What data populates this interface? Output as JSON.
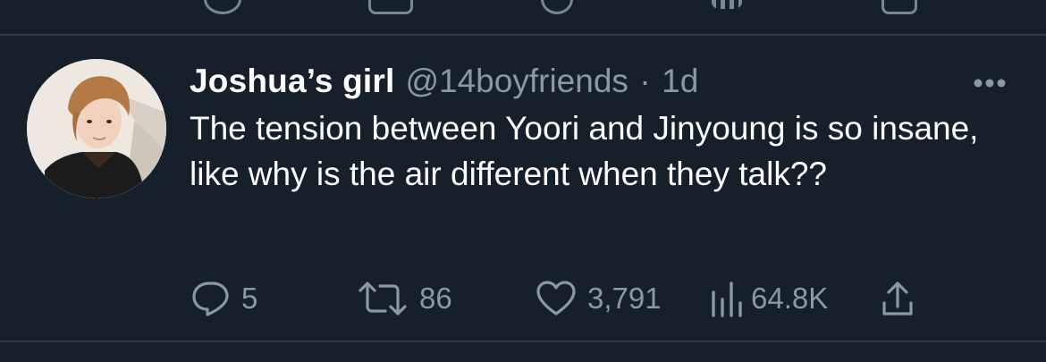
{
  "tweet": {
    "author_name": "Joshua’s girl",
    "author_handle": "@14boyfriends",
    "separator": "·",
    "time": "1d",
    "text": "The tension between Yoori and Jinyoung is so insane, like why is the air different when they talk??"
  },
  "actions": {
    "replies": "5",
    "retweets": "86",
    "likes": "3,791",
    "views": "64.8K"
  },
  "icons": {
    "reply": "reply-icon",
    "retweet": "retweet-icon",
    "like": "heart-icon",
    "views": "views-bar-chart-icon",
    "share": "share-icon",
    "more": "more-dots-icon"
  },
  "colors": {
    "background": "#15202b",
    "text_primary": "#ffffff",
    "text_secondary": "#8b98a5",
    "divider": "#2f3a45"
  }
}
